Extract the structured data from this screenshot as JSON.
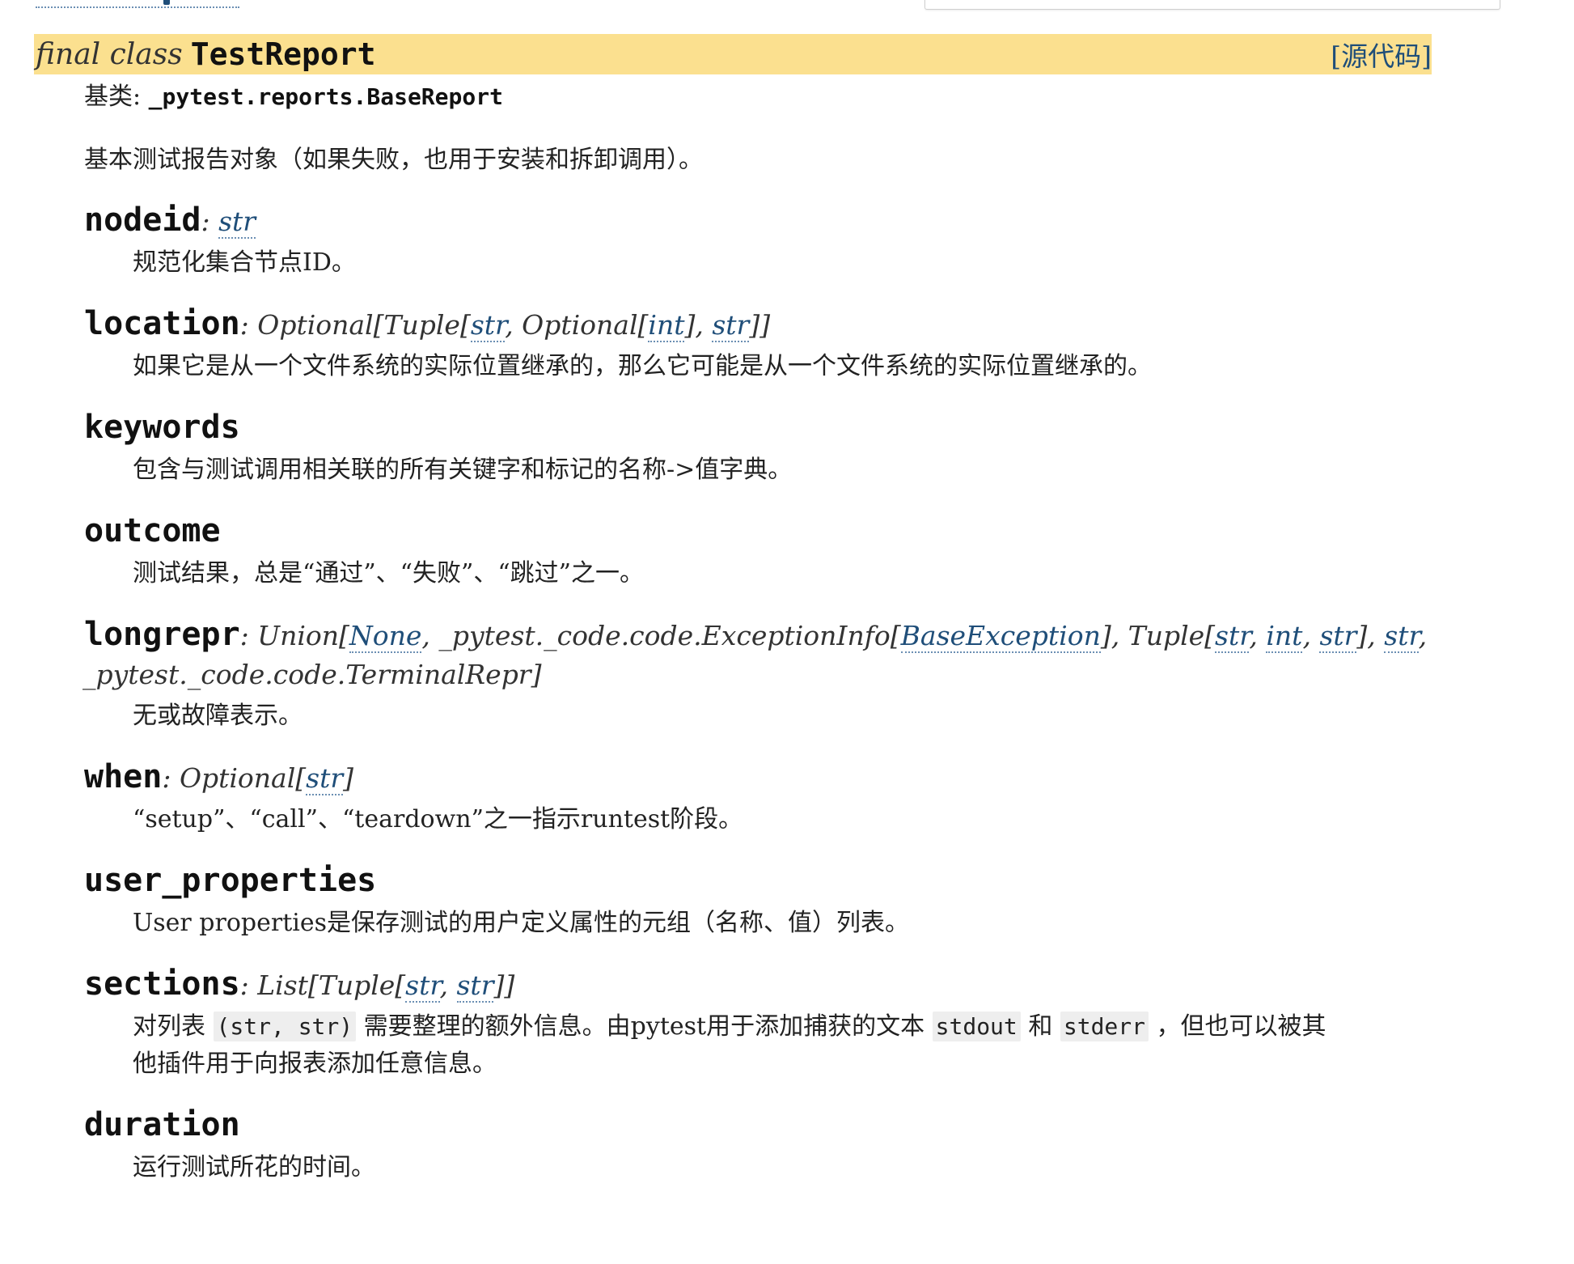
{
  "signature": {
    "property": "final class",
    "class_name": "TestReport",
    "source_link": "[源代码]"
  },
  "bases": {
    "label": "基类:",
    "value": "_pytest.reports.BaseReport"
  },
  "description": "基本测试报告对象（如果失败，也用于安装和拆卸调用）。",
  "attributes": {
    "nodeid": {
      "name": "nodeid",
      "sep": ": ",
      "type_parts": [
        "str"
      ],
      "doc": "规范化集合节点ID。"
    },
    "location": {
      "name": "location",
      "sep": ": ",
      "t1": "Optional[Tuple[",
      "l1": "str",
      "t2": ", Optional[",
      "l2": "int",
      "t3": "], ",
      "l3": "str",
      "t4": "]]",
      "doc": "如果它是从一个文件系统的实际位置继承的，那么它可能是从一个文件系统的实际位置继承的。"
    },
    "keywords": {
      "name": "keywords",
      "doc": "包含与测试调用相关联的所有关键字和标记的名称->值字典。"
    },
    "outcome": {
      "name": "outcome",
      "doc": "测试结果，总是“通过”、“失败”、“跳过”之一。"
    },
    "longrepr": {
      "name": "longrepr",
      "sep": ": ",
      "t1": "Union[",
      "l1": "None",
      "t2": ", _pytest._code.code.ExceptionInfo[",
      "l2": "BaseException",
      "t3": "], Tuple[",
      "l3": "str",
      "t4": ", ",
      "l4": "int",
      "t5": ", ",
      "l5": "str",
      "t6": "], ",
      "l6": "str",
      "t7": ",",
      "line2": "_pytest._code.code.TerminalRepr]",
      "doc": "无或故障表示。"
    },
    "when": {
      "name": "when",
      "sep": ": ",
      "t1": "Optional[",
      "l1": "str",
      "t2": "]",
      "doc": "“setup”、“call”、“teardown”之一指示runtest阶段。"
    },
    "user_properties": {
      "name": "user_properties",
      "doc": "User properties是保存测试的用户定义属性的元组（名称、值）列表。"
    },
    "sections": {
      "name": "sections",
      "sep": ": ",
      "t1": "List[Tuple[",
      "l1": "str",
      "t2": ", ",
      "l2": "str",
      "t3": "]]",
      "doc_a": "对列表 ",
      "code1": "(str, str)",
      "doc_b": " 需要整理的额外信息。由pytest用于添加捕获的文本 ",
      "code2": "stdout",
      "doc_c": " 和 ",
      "code3": "stderr",
      "doc_d": " ，但也可以被其",
      "doc_e": "他插件用于向报表添加任意信息。"
    },
    "duration": {
      "name": "duration",
      "doc": "运行测试所花的时间。"
    }
  }
}
